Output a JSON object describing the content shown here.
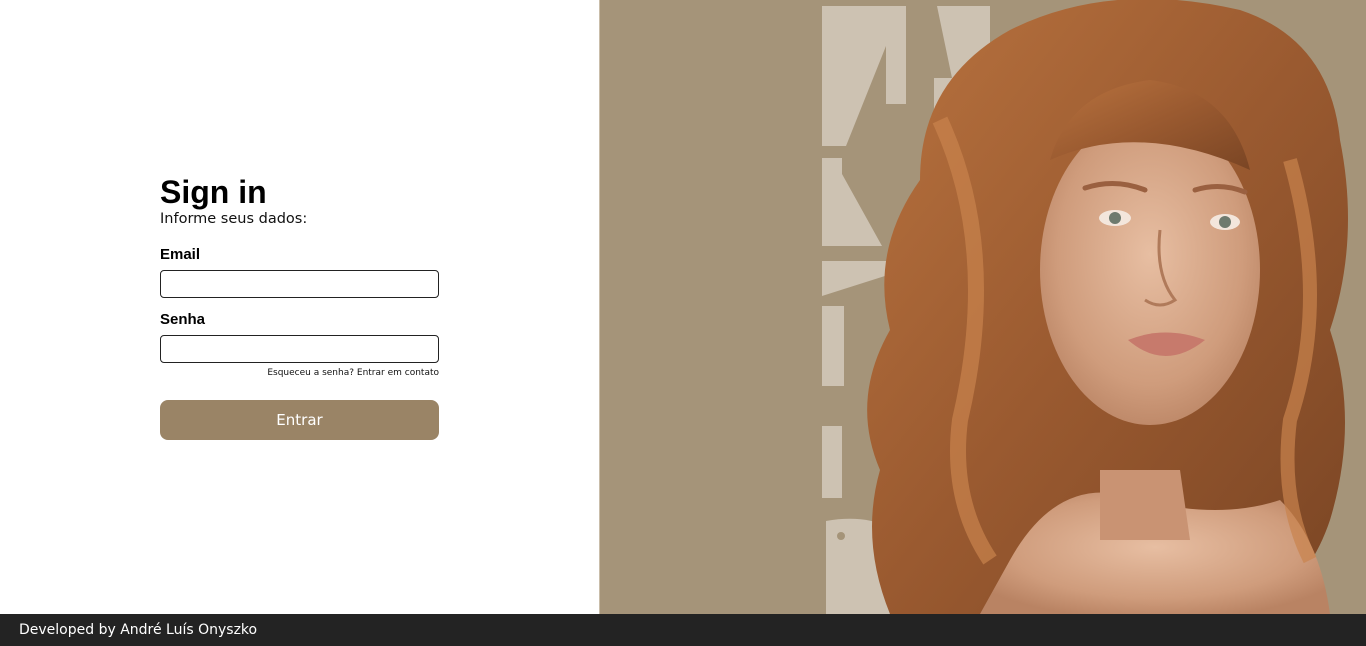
{
  "login": {
    "title": "Sign in",
    "subtitle": "Informe seus dados:",
    "email_label": "Email",
    "email_value": "",
    "password_label": "Senha",
    "password_value": "",
    "forgot_text": "Esqueceu a senha?",
    "contact_link": "Entrar em contato",
    "submit_label": "Entrar"
  },
  "footer": {
    "credit": "Developed by André Luís Onyszko"
  },
  "colors": {
    "accent": "#9a8466",
    "hero_background": "#a59479",
    "footer_background": "#232323"
  }
}
